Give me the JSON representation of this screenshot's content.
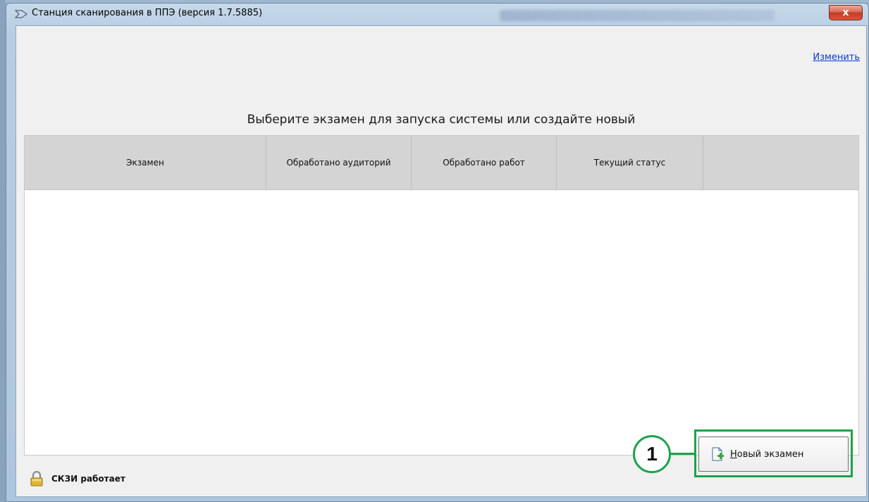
{
  "window": {
    "title": "Станция сканирования в ППЭ (версия 1.7.5885)",
    "close_label": "x"
  },
  "header": {
    "change_link": "Изменить",
    "page_title": "Выберите экзамен для запуска системы или создайте новый"
  },
  "table": {
    "columns": [
      "Экзамен",
      "Обработано аудиторий",
      "Обработано работ",
      "Текущий статус",
      ""
    ],
    "rows": []
  },
  "footer": {
    "status_text": "СКЗИ работает",
    "new_exam_first_letter": "Н",
    "new_exam_rest": "овый экзамен"
  },
  "annotation": {
    "callout_number": "1",
    "color": "#1ca24a"
  },
  "icons": {
    "title": "arrow-app-icon",
    "status": "lock-icon",
    "new_exam": "document-add-icon"
  }
}
